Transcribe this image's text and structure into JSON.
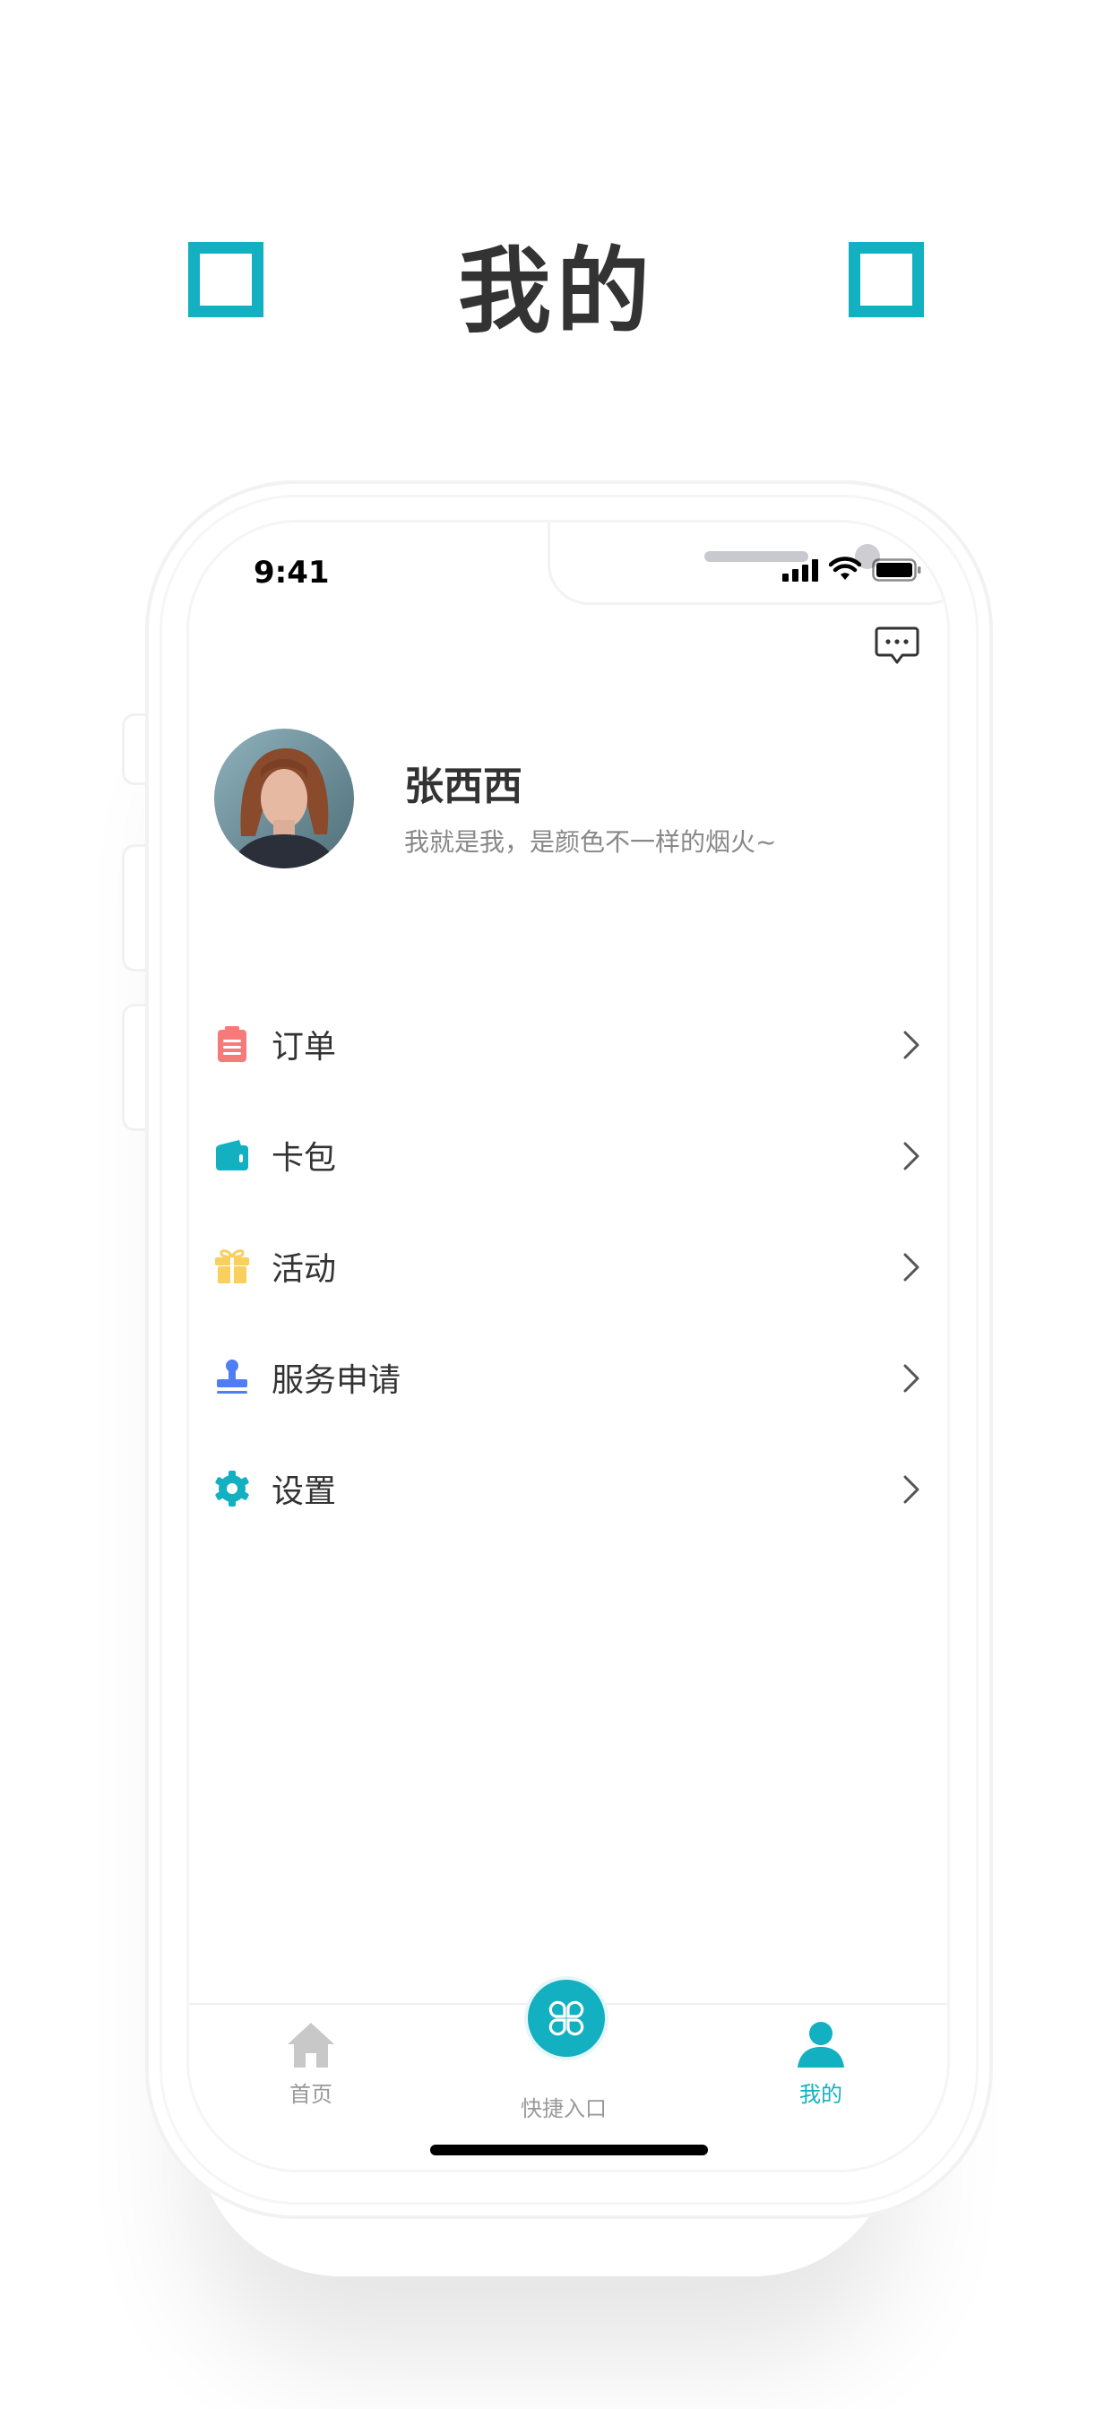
{
  "page": {
    "title": "我的",
    "accent_color": "#12B0C1"
  },
  "status_bar": {
    "time": "9:41",
    "icons": [
      "cellular-signal-icon",
      "wifi-icon",
      "battery-icon"
    ]
  },
  "header": {
    "message_icon": "message-bubble-icon"
  },
  "profile": {
    "name": "张西西",
    "bio": "我就是我，是颜色不一样的烟火~",
    "avatar": "avatar-photo"
  },
  "menu": {
    "items": [
      {
        "label": "订单",
        "icon": "clipboard-icon",
        "color": "#F77A7B"
      },
      {
        "label": "卡包",
        "icon": "wallet-icon",
        "color": "#12B0C1"
      },
      {
        "label": "活动",
        "icon": "gift-icon",
        "color": "#F9CF5E"
      },
      {
        "label": "服务申请",
        "icon": "stamp-icon",
        "color": "#4F7DF2"
      },
      {
        "label": "设置",
        "icon": "gear-icon",
        "color": "#12B0C1"
      }
    ]
  },
  "tabbar": {
    "tabs": [
      {
        "label": "首页",
        "icon": "home-icon",
        "active": false
      },
      {
        "label": "快捷入口",
        "icon": "clover-icon",
        "active": false
      },
      {
        "label": "我的",
        "icon": "user-icon",
        "active": true
      }
    ],
    "inactive_color": "#999999",
    "active_color": "#12B0C1"
  }
}
